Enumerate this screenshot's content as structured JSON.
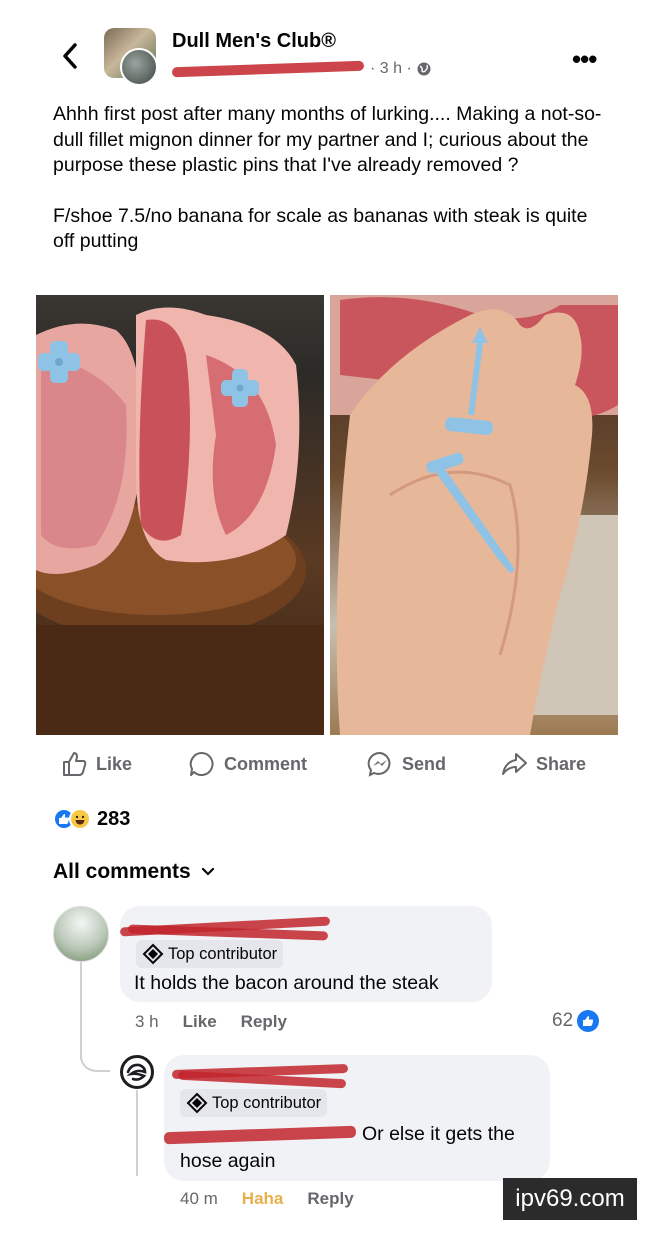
{
  "post": {
    "group_name": "Dull Men's Club®",
    "time": "· 3 h ·",
    "text": [
      "Ahhh first post after many months of lurking.... Making a not-so-dull fillet mignon dinner for my partner and I; curious about the purpose these plastic pins that I've already removed ?",
      "F/shoe 7.5/no banana for scale as bananas with steak is quite off putting"
    ]
  },
  "actions": {
    "like": "Like",
    "comment": "Comment",
    "send": "Send",
    "share": "Share"
  },
  "reactions": {
    "count": "283"
  },
  "comments_header": "All comments",
  "comments": [
    {
      "badge": "Top contributor",
      "text": "It holds the bacon around the steak",
      "time": "3 h",
      "like": "Like",
      "reply": "Reply",
      "like_count": "62"
    },
    {
      "badge": "Top contributor",
      "text_line1": "Or else it gets the",
      "text_line2": "hose again",
      "time": "40 m",
      "reaction": "Haha",
      "reply": "Reply"
    }
  ],
  "watermark": "ipv69.com",
  "colors": {
    "accent": "#1877f2",
    "muted": "#65676b",
    "redaction": "#c2242c",
    "bubble": "#f0f2f5",
    "haha": "#e8b04a"
  }
}
